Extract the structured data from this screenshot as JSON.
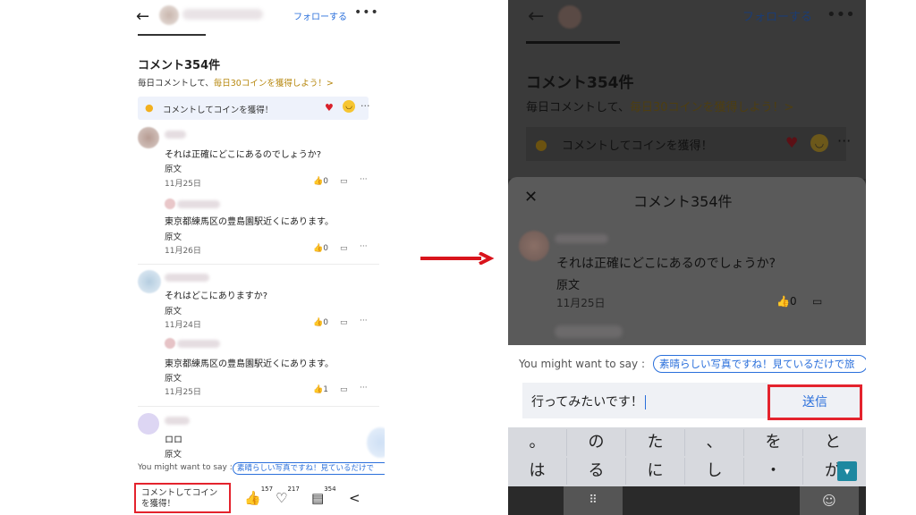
{
  "left": {
    "follow_label": "フォローする",
    "more_label": "•••",
    "back_label": "←",
    "title": "コメント354件",
    "promo_prefix": "毎日コメントして、",
    "promo_highlight": "毎日30コインを獲得しよう！>",
    "bar_text": "コメントしてコインを獲得！",
    "comments": [
      {
        "text": "それは正確にどこにあるのでしょうか?",
        "source": "原文",
        "date": "11月25日",
        "likes": "0"
      },
      {
        "text": "東京都練馬区の豊島園駅近くにあります。",
        "source": "原文",
        "date": "11月26日",
        "likes": "0"
      },
      {
        "text": "それはどこにありますか?",
        "source": "原文",
        "date": "11月24日",
        "likes": "0"
      },
      {
        "text": "東京都練馬区の豊島園駅近くにあります。",
        "source": "原文",
        "date": "11月25日",
        "likes": "1"
      },
      {
        "text": "ロロ",
        "source": "原文"
      }
    ],
    "suggest_label": "You might want to say :",
    "suggest_chip": "素晴らしい写真ですね！見ているだけで",
    "input_placeholder": "コメントしてコインを獲得！",
    "stats": {
      "like": "157",
      "heart": "217",
      "comment": "354"
    }
  },
  "right": {
    "back_label": "←",
    "follow_label": "フォローする",
    "more_label": "•••",
    "title": "コメント354件",
    "promo_prefix": "毎日コメントして、",
    "promo_highlight": "毎日30コインを獲得しよう！>",
    "bar_text": "コメントしてコインを獲得！",
    "sheet_title": "コメント354件",
    "sheet_comment": {
      "text": "それは正確にどこにあるのでしょうか?",
      "source": "原文",
      "date": "11月25日",
      "likes": "0"
    },
    "suggest_label": "You might want to say :",
    "suggest_chip": "素晴らしい写真ですね！見ているだけで旅",
    "input_value": "行ってみたいです！",
    "send_label": "送信",
    "keyboard_row1": [
      "。",
      "の",
      "た",
      "、",
      "を",
      "と"
    ],
    "keyboard_row2": [
      "は",
      "る",
      "に",
      "し",
      "・",
      "が"
    ]
  },
  "colors": {
    "accent": "#2a6fdb",
    "highlight_box": "#e4232d",
    "gold": "#b7880f",
    "arrow": "#d9141c"
  }
}
